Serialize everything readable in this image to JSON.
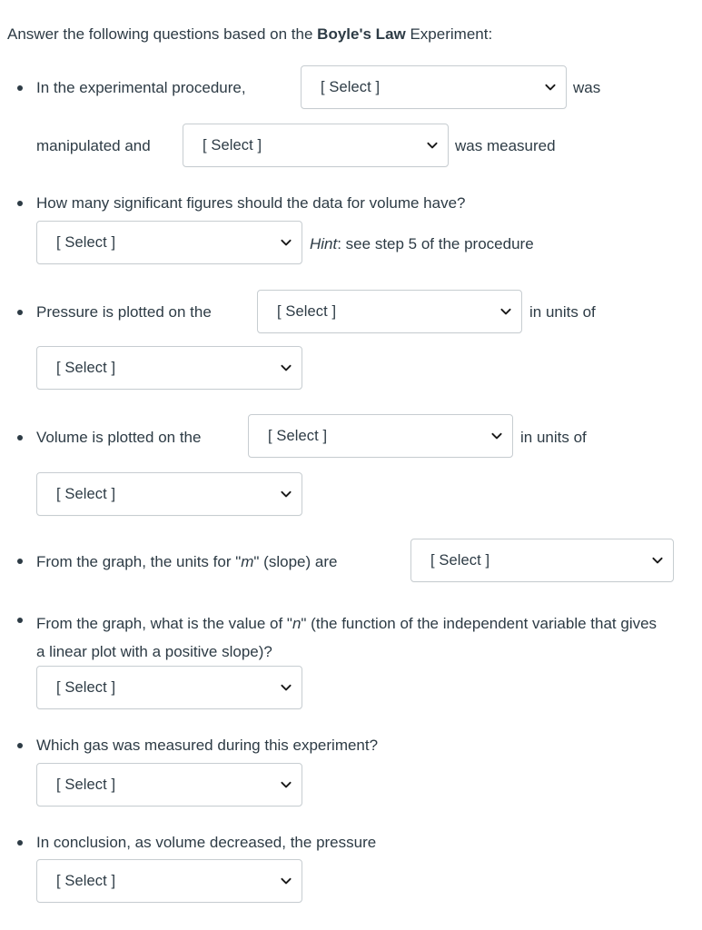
{
  "intro": {
    "prefix": "Answer the following questions based on the ",
    "emphasis": "Boyle's Law",
    "suffix": " Experiment:"
  },
  "select_placeholder": "[ Select ]",
  "icons": {
    "dropdown": "chevron-down-icon",
    "bullet": "bullet-dot-icon"
  },
  "colors": {
    "text": "#2d3b45",
    "border": "#c7cdd1",
    "field_background": "#ffffff",
    "page_background": "#ffffff"
  },
  "questions": [
    {
      "id": "experimental-procedure",
      "segments": [
        {
          "type": "text",
          "value": "In the experimental procedure,"
        },
        {
          "type": "select",
          "value": "[ Select ]"
        },
        {
          "type": "text",
          "value": "was"
        },
        {
          "type": "text",
          "value": "manipulated and"
        },
        {
          "type": "select",
          "value": "[ Select ]"
        },
        {
          "type": "text",
          "value": "was measured"
        }
      ]
    },
    {
      "id": "significant-figures",
      "prompt": "How many significant figures should the data for volume have?",
      "select": "[ Select ]",
      "hint_label": "Hint",
      "hint_text": ": see step 5 of the procedure"
    },
    {
      "id": "pressure-axis",
      "lead": "Pressure is plotted on the",
      "axis_select": "[ Select ]",
      "trail": "in units of",
      "units_select": "[ Select ]"
    },
    {
      "id": "volume-axis",
      "lead": "Volume is plotted on the",
      "axis_select": "[ Select ]",
      "trail": "in units of",
      "units_select": "[ Select ]"
    },
    {
      "id": "slope-units",
      "lead_a": "From the graph, the units for \"",
      "lead_var": "m",
      "lead_b": "\" (slope) are",
      "select": "[ Select ]"
    },
    {
      "id": "value-of-n",
      "prompt_a": "From the graph, what is the value of \"",
      "prompt_var": "n",
      "prompt_b": "\" (the function of the independent variable that gives a linear plot with a positive slope)?",
      "select": "[ Select ]"
    },
    {
      "id": "gas-measured",
      "prompt": "Which gas was measured during this experiment?",
      "select": "[ Select ]"
    },
    {
      "id": "conclusion",
      "prompt": "In conclusion, as volume decreased, the pressure",
      "select": "[ Select ]"
    }
  ]
}
